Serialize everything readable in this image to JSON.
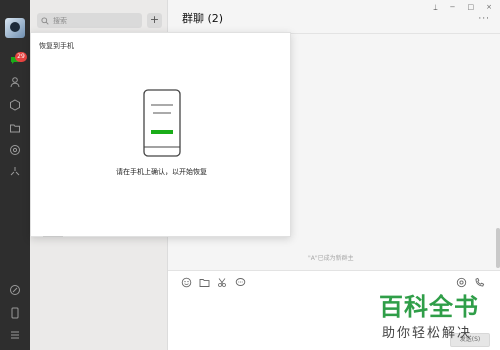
{
  "sidebar": {
    "badge_count": "29",
    "icons": [
      "chat-icon",
      "contacts-icon",
      "favorites-icon",
      "files-icon",
      "moments-icon",
      "miniprogram-icon",
      "link-icon",
      "phone-icon",
      "menu-icon"
    ]
  },
  "chat_list": {
    "search_placeholder": "搜索",
    "add_label": "+"
  },
  "chat": {
    "title": "群聊 (2)",
    "more_label": "···",
    "system_message": "\"A\"已成为新群主",
    "send_label": "发送(S)"
  },
  "window_controls": {
    "pin": "⍊",
    "minimize": "−",
    "maximize": "□",
    "close": "×"
  },
  "restore_popup": {
    "title": "恢复到手机",
    "message": "请在手机上确认，以开始恢复",
    "accent_color": "#1aad19"
  },
  "watermark": {
    "title": "百科全书",
    "subtitle": "助你轻松解决"
  }
}
